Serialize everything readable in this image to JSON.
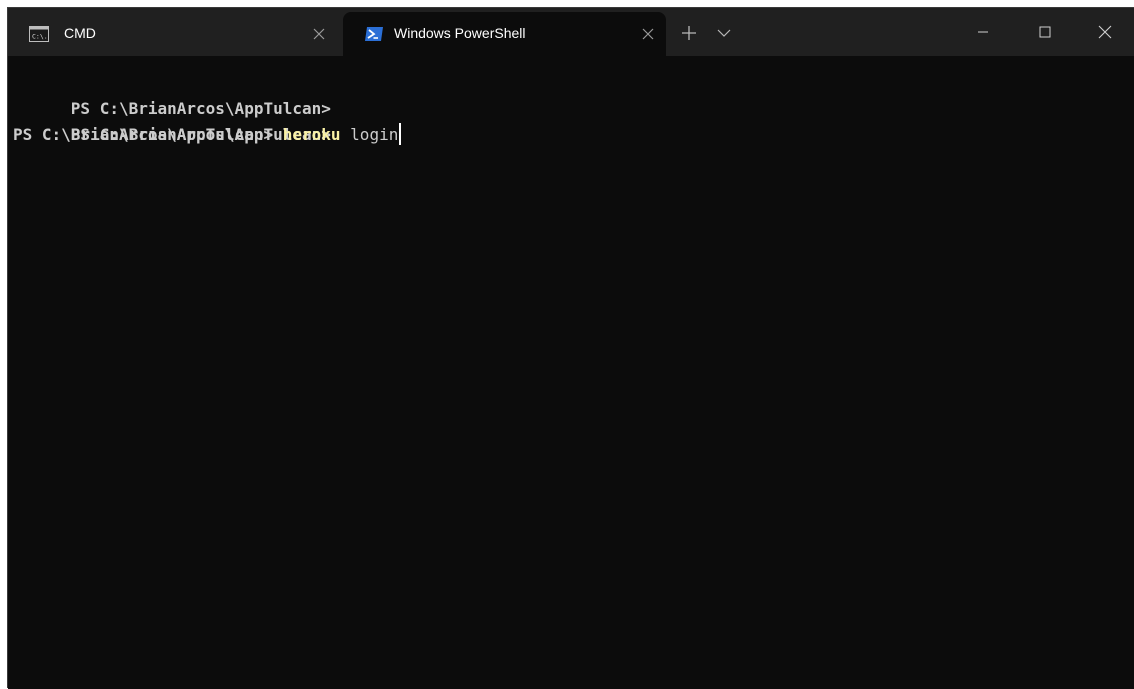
{
  "window": {
    "tabs": [
      {
        "label": "CMD",
        "icon": "cmd-icon",
        "active": false
      },
      {
        "label": "Windows PowerShell",
        "icon": "powershell-icon",
        "active": true
      }
    ],
    "new_tab_icon": "plus-icon",
    "dropdown_icon": "chevron-down-icon",
    "controls": [
      "minimize-icon",
      "maximize-icon",
      "close-icon"
    ]
  },
  "terminal": {
    "lines": [
      {
        "prompt": "PS C:\\BrianArcos\\AppTulcan>",
        "command": "",
        "argument": ""
      },
      {
        "prompt": "PS C:\\BrianArcos\\AppTulcan>",
        "command": "",
        "argument": ""
      },
      {
        "prompt": "PS C:\\BrianArcos\\AppTulcan>",
        "command": "heroku",
        "argument": "login"
      }
    ]
  },
  "colors": {
    "terminal_background": "#0c0c0c",
    "titlebar_background": "#202020",
    "command_highlight": "#f9f1a5",
    "text": "#cccccc",
    "powershell_icon": "#2b6fd6"
  }
}
